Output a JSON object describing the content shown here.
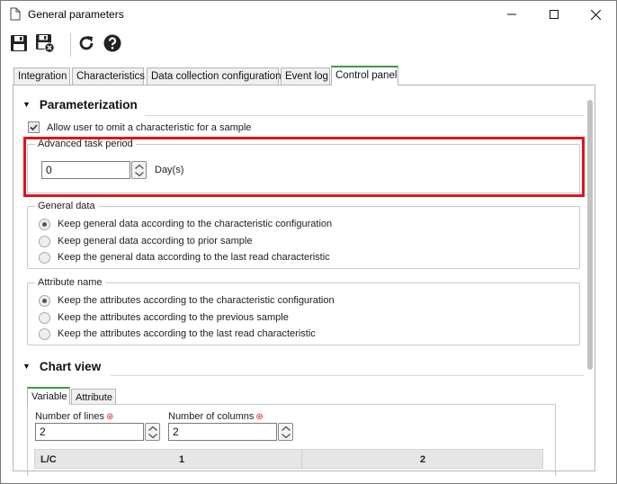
{
  "window": {
    "title": "General parameters"
  },
  "toolbar": {
    "save": "save-icon",
    "save_close": "save-close-icon",
    "refresh": "refresh-icon",
    "help": "help-icon"
  },
  "tabs": [
    "Integration",
    "Characteristics",
    "Data collection configuration",
    "Event log",
    "Control panel"
  ],
  "parameterization": {
    "heading": "Parameterization",
    "omit_checkbox": {
      "label": "Allow user to omit a characteristic for a sample",
      "checked": true
    },
    "advanced_task_period": {
      "legend": "Advanced task period",
      "value": "0",
      "unit": "Day(s)"
    },
    "general_data": {
      "legend": "General data",
      "options": [
        "Keep general data according to the characteristic configuration",
        "Keep general data according to prior sample",
        "Keep the general data according to the last read characteristic"
      ],
      "selected": 0
    },
    "attribute_name": {
      "legend": "Attribute name",
      "options": [
        "Keep the attributes according to the characteristic configuration",
        "Keep the attributes according to the previous sample",
        "Keep the attributes according to the last read characteristic"
      ],
      "selected": 0
    }
  },
  "chart_view": {
    "heading": "Chart view",
    "subtabs": [
      "Variable",
      "Attribute"
    ],
    "lines": {
      "label": "Number of lines",
      "value": "2"
    },
    "columns": {
      "label": "Number of columns",
      "value": "2"
    },
    "grid": {
      "corner": "L/C",
      "col1": "1",
      "col2": "2"
    }
  },
  "colors": {
    "accent_tab": "#3c9b46",
    "highlight": "#e0141e",
    "required": "#d62020"
  }
}
